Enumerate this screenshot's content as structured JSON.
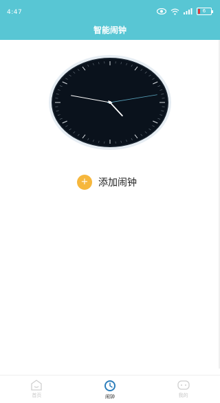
{
  "status_bar": {
    "time": "4:47",
    "battery_level": "6"
  },
  "header": {
    "title": "智能闹钟"
  },
  "clock": {
    "hour": 4,
    "minute": 47,
    "second": 13
  },
  "add_alarm": {
    "icon": "+",
    "label": "添加闹钟"
  },
  "bottom_nav": {
    "items": [
      {
        "label": "首页",
        "icon": "home-icon",
        "active": false
      },
      {
        "label": "闹钟",
        "icon": "clock-icon",
        "active": true
      },
      {
        "label": "我的",
        "icon": "profile-icon",
        "active": false
      }
    ]
  },
  "colors": {
    "header_bg": "#58c6d4",
    "accent_orange": "#f6b73d",
    "clock_face": "#0a121c"
  }
}
